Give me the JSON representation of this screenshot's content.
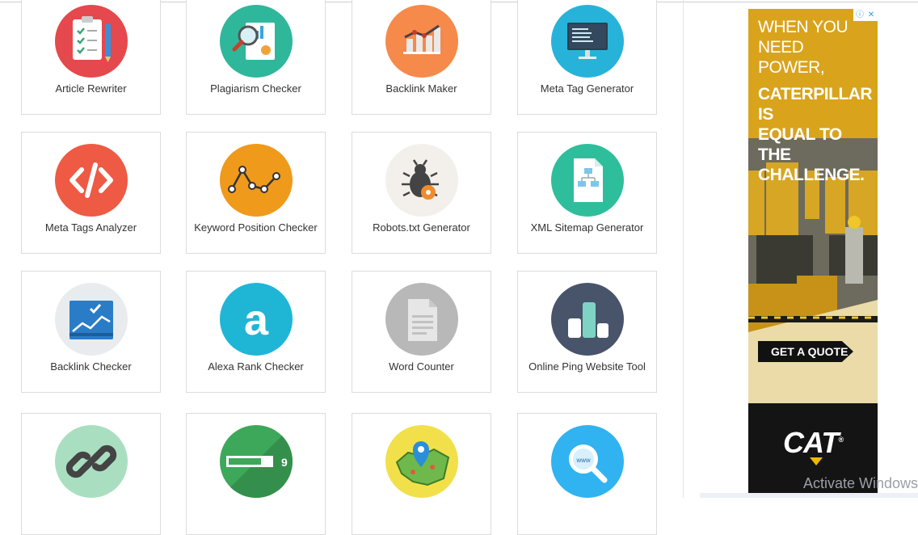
{
  "tools": [
    {
      "label": "Article Rewriter",
      "icon": "article-rewriter-icon",
      "color": "#e5484d"
    },
    {
      "label": "Plagiarism Checker",
      "icon": "plagiarism-checker-icon",
      "color": "#2fb79b"
    },
    {
      "label": "Backlink Maker",
      "icon": "backlink-maker-icon",
      "color": "#f58a4b"
    },
    {
      "label": "Meta Tag Generator",
      "icon": "meta-tag-generator-icon",
      "color": "#27b3d9"
    },
    {
      "label": "Meta Tags Analyzer",
      "icon": "meta-tags-analyzer-icon",
      "color": "#ee5a44"
    },
    {
      "label": "Keyword Position Checker",
      "icon": "keyword-position-checker-icon",
      "color": "#ef9a1b"
    },
    {
      "label": "Robots.txt Generator",
      "icon": "robots-txt-generator-icon",
      "color": "#f3f0ec"
    },
    {
      "label": "XML Sitemap Generator",
      "icon": "xml-sitemap-generator-icon",
      "color": "#2fbe9c"
    },
    {
      "label": "Backlink Checker",
      "icon": "backlink-checker-icon",
      "color": "#e8ecef"
    },
    {
      "label": "Alexa Rank Checker",
      "icon": "alexa-rank-checker-icon",
      "color": "#1fb6d6"
    },
    {
      "label": "Word Counter",
      "icon": "word-counter-icon",
      "color": "#b8b8b8"
    },
    {
      "label": "Online Ping Website Tool",
      "icon": "online-ping-website-tool-icon",
      "color": "#47546a"
    },
    {
      "label": "",
      "icon": "link-icon",
      "color": "#a9dfc0"
    },
    {
      "label": "",
      "icon": "progress-bar-icon",
      "color": "#3da85a"
    },
    {
      "label": "",
      "icon": "map-pin-icon",
      "color": "#f2e04a"
    },
    {
      "label": "",
      "icon": "search-www-icon",
      "color": "#30b3f0"
    }
  ],
  "ad": {
    "headline_1": "WHEN YOU",
    "headline_2": "NEED POWER,",
    "headline_3": "CATERPILLAR IS",
    "headline_4": "EQUAL TO THE",
    "headline_5": "CHALLENGE.",
    "cta": "GET A QUOTE",
    "logo": "CAT",
    "logo_mark": "®",
    "brand_yellow": "#f2b800",
    "choices_info": "ⓘ",
    "choices_close": "✕"
  },
  "watermark": "Activate Windows"
}
